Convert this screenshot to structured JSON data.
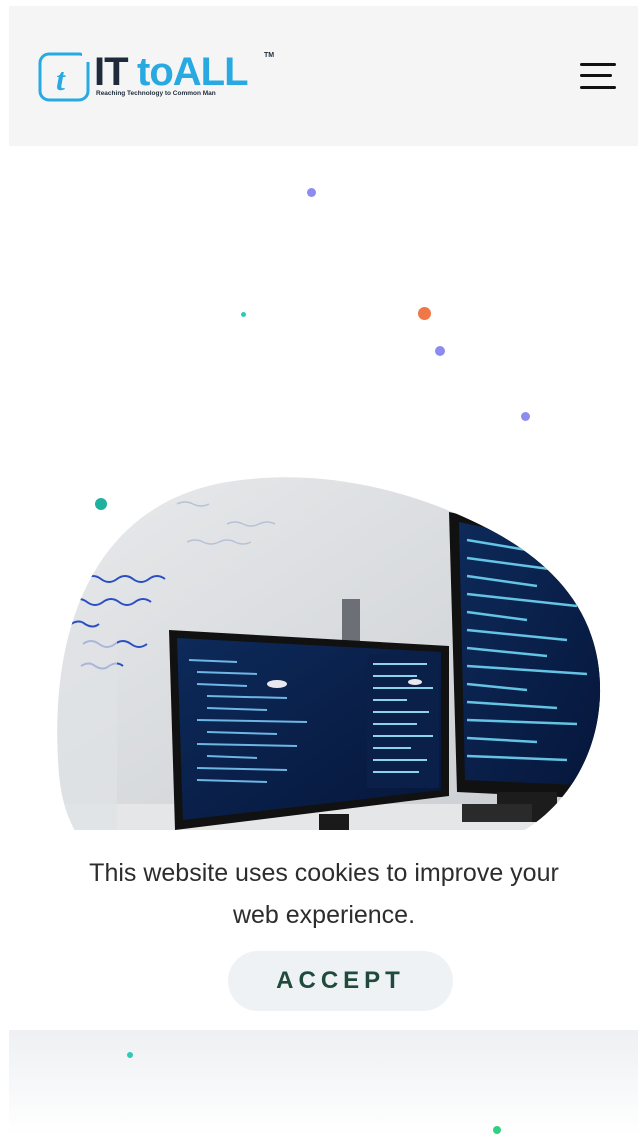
{
  "header": {
    "logo": {
      "mark_letter": "t",
      "word_it": "IT",
      "word_toall": "toALL",
      "trademark": "TM",
      "tagline": "Reaching Technology to Common Man"
    },
    "menu_icon": "hamburger-menu-icon"
  },
  "hero": {
    "image": "computer-monitors-with-code-and-whiteboard",
    "whiteboard_scribbles": [
      "if(value_done)",
      "whats not in prod",
      "update",
      "dev: critical",
      "-> no good"
    ]
  },
  "cookie_banner": {
    "message": "This website uses cookies to improve your web experience.",
    "accept_label": "ACCEPT"
  },
  "colors": {
    "header_bg": "#f5f5f5",
    "logo_blue": "#29a9e1",
    "logo_dark": "#1f2a3a",
    "accept_bg": "#eef2f4",
    "accept_text": "#204a3c",
    "dot_purple": "#8c8cf0",
    "dot_orange": "#f07848",
    "dot_teal": "#20b0a0",
    "dot_green": "#30d080"
  }
}
